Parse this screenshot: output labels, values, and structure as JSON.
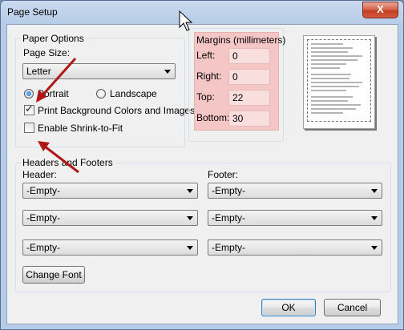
{
  "window": {
    "title": "Page Setup",
    "close_label": "X"
  },
  "paper_options": {
    "group_label": "Paper Options",
    "page_size_label": "Page Size:",
    "page_size_value": "Letter",
    "orientation": {
      "portrait_label": "Portrait",
      "landscape_label": "Landscape",
      "selected": "portrait"
    },
    "print_bg_label": "Print Background Colors and Images",
    "print_bg_checked": true,
    "shrink_label": "Enable Shrink-to-Fit",
    "shrink_checked": false
  },
  "margins": {
    "group_label": "Margins (millimeters)",
    "left_label": "Left:",
    "left_value": "0",
    "right_label": "Right:",
    "right_value": "0",
    "top_label": "Top:",
    "top_value": "22",
    "bottom_label": "Bottom:",
    "bottom_value": "30",
    "highlight_color": "#f5c6c6"
  },
  "headers_footers": {
    "group_label": "Headers and Footers",
    "header_label": "Header:",
    "footer_label": "Footer:",
    "header_values": [
      "-Empty-",
      "-Empty-",
      "-Empty-"
    ],
    "footer_values": [
      "-Empty-",
      "-Empty-",
      "-Empty-"
    ],
    "change_font_label": "Change Font"
  },
  "buttons": {
    "ok_label": "OK",
    "cancel_label": "Cancel"
  },
  "annotation_color": "#b01818"
}
